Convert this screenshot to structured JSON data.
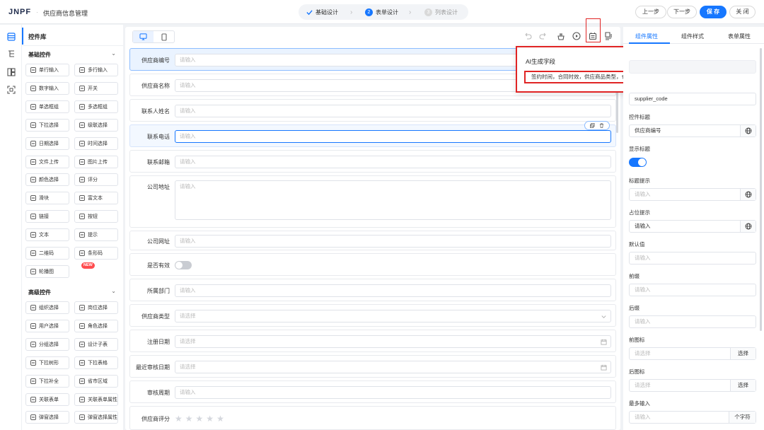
{
  "header": {
    "logo_main": "JNPF",
    "separator": "·",
    "title": "供应商信息管理",
    "steps": [
      {
        "num": "",
        "label": "基础设计",
        "state": "done"
      },
      {
        "num": "2",
        "label": "表单设计",
        "state": "active"
      },
      {
        "num": "3",
        "label": "列表设计",
        "state": "pending"
      }
    ],
    "prev_label": "上一步",
    "next_label": "下一步",
    "save_label": "保 存",
    "close_label": "关 闭"
  },
  "library": {
    "title": "控件库",
    "basic_section": "基础控件",
    "basic": [
      {
        "label": "单行输入",
        "icon": "input-icon"
      },
      {
        "label": "多行输入",
        "icon": "textarea-icon"
      },
      {
        "label": "数字输入",
        "icon": "number-icon"
      },
      {
        "label": "开关",
        "icon": "switch-icon"
      },
      {
        "label": "单选框组",
        "icon": "radio-icon"
      },
      {
        "label": "多选框组",
        "icon": "checkbox-icon"
      },
      {
        "label": "下拉选择",
        "icon": "select-icon"
      },
      {
        "label": "级联选择",
        "icon": "cascader-icon"
      },
      {
        "label": "日期选择",
        "icon": "calendar-icon"
      },
      {
        "label": "时间选择",
        "icon": "clock-icon"
      },
      {
        "label": "文件上传",
        "icon": "upload-icon"
      },
      {
        "label": "图片上传",
        "icon": "image-upload-icon"
      },
      {
        "label": "颜色选择",
        "icon": "palette-icon"
      },
      {
        "label": "评分",
        "icon": "star-icon"
      },
      {
        "label": "滑块",
        "icon": "slider-icon"
      },
      {
        "label": "富文本",
        "icon": "richtext-icon"
      },
      {
        "label": "链接",
        "icon": "link-icon"
      },
      {
        "label": "按钮",
        "icon": "button-icon"
      },
      {
        "label": "文本",
        "icon": "text-icon"
      },
      {
        "label": "提示",
        "icon": "info-icon"
      },
      {
        "label": "二维码",
        "icon": "qrcode-icon"
      },
      {
        "label": "条形码",
        "icon": "barcode-icon"
      },
      {
        "label": "轮播图",
        "icon": "carousel-icon"
      }
    ],
    "new_badge": "NEW",
    "advanced_section": "高级控件",
    "advanced": [
      {
        "label": "组织选择",
        "icon": "org-icon"
      },
      {
        "label": "岗位选择",
        "icon": "position-icon"
      },
      {
        "label": "用户选择",
        "icon": "user-icon"
      },
      {
        "label": "角色选择",
        "icon": "role-icon"
      },
      {
        "label": "分组选择",
        "icon": "group-icon"
      },
      {
        "label": "设计子表",
        "icon": "table-icon"
      },
      {
        "label": "下拉树形",
        "icon": "tree-icon"
      },
      {
        "label": "下拉表格",
        "icon": "dropdown-table-icon"
      },
      {
        "label": "下拉补全",
        "icon": "autocomplete-icon"
      },
      {
        "label": "省市区域",
        "icon": "region-icon"
      },
      {
        "label": "关联表单",
        "icon": "relation-form-icon"
      },
      {
        "label": "关联表单属性",
        "icon": "relation-attr-icon"
      },
      {
        "label": "弹窗选择",
        "icon": "popup-icon"
      },
      {
        "label": "弹窗选择属性",
        "icon": "popup-attr-icon"
      }
    ]
  },
  "form": {
    "fields": [
      {
        "label": "供应商编号",
        "placeholder": "请输入",
        "type": "input",
        "state": "selected"
      },
      {
        "label": "供应商名称",
        "placeholder": "请输入",
        "type": "input"
      },
      {
        "label": "联系人姓名",
        "placeholder": "请输入",
        "type": "input"
      },
      {
        "label": "联系电话",
        "placeholder": "请输入",
        "type": "input",
        "state": "hover"
      },
      {
        "label": "联系邮箱",
        "placeholder": "请输入",
        "type": "input"
      },
      {
        "label": "公司地址",
        "placeholder": "请输入",
        "type": "textarea"
      },
      {
        "label": "公司网址",
        "placeholder": "请输入",
        "type": "input"
      },
      {
        "label": "是否有效",
        "placeholder": "",
        "type": "switch"
      },
      {
        "label": "所属部门",
        "placeholder": "请输入",
        "type": "input"
      },
      {
        "label": "供应商类型",
        "placeholder": "请选择",
        "type": "select"
      },
      {
        "label": "注册日期",
        "placeholder": "请选择",
        "type": "date"
      },
      {
        "label": "最近审核日期",
        "placeholder": "请选择",
        "type": "date"
      },
      {
        "label": "审核周期",
        "placeholder": "请输入",
        "type": "input"
      },
      {
        "label": "供应商评分",
        "placeholder": "",
        "type": "rate",
        "max": 5,
        "value": 0
      }
    ]
  },
  "ai_popup": {
    "title": "AI生成字段",
    "input_value": "签约时间，合同时效，供应商品类型，仓库地址"
  },
  "properties": {
    "tabs": [
      "组件属性",
      "组件样式",
      "表单属性"
    ],
    "field_id_value": "supplier_code",
    "title_label": "控件标题",
    "title_value": "供应商编号",
    "show_title_label": "显示标题",
    "show_title_on": true,
    "title_tip_label": "标题提示",
    "title_tip_placeholder": "请输入",
    "placeholder_label": "占位提示",
    "placeholder_value": "请输入",
    "default_label": "默认值",
    "default_placeholder": "请输入",
    "prefix_label": "前缀",
    "prefix_placeholder": "请输入",
    "suffix_label": "后缀",
    "suffix_placeholder": "请输入",
    "prefix_icon_label": "前图标",
    "prefix_icon_placeholder": "请选择",
    "select_label": "选择",
    "suffix_icon_label": "后图标",
    "suffix_icon_placeholder": "请选择",
    "max_input_label": "最多输入",
    "max_input_placeholder": "请输入",
    "max_input_unit": "个字符"
  },
  "colors": {
    "primary": "#1677ff",
    "highlight": "#e02424",
    "logo_accent": "#e8743c"
  }
}
